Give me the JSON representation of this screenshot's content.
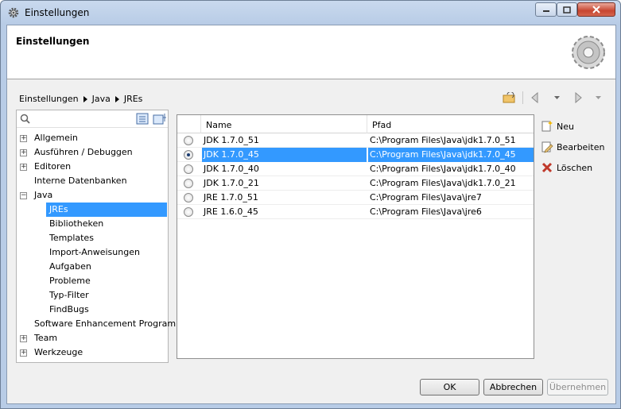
{
  "window": {
    "title": "Einstellungen"
  },
  "banner": {
    "title": "Einstellungen"
  },
  "breadcrumb": [
    "Einstellungen",
    "Java",
    "JREs"
  ],
  "filter": {
    "value": ""
  },
  "tree": [
    {
      "label": "Allgemein",
      "expandable": true
    },
    {
      "label": "Ausführen / Debuggen",
      "expandable": true
    },
    {
      "label": "Editoren",
      "expandable": true
    },
    {
      "label": "Interne Datenbanken",
      "expandable": false
    },
    {
      "label": "Java",
      "expandable": true,
      "expanded": true
    },
    {
      "label": "JREs",
      "child": true,
      "selected": true
    },
    {
      "label": "Bibliotheken",
      "child": true
    },
    {
      "label": "Templates",
      "child": true
    },
    {
      "label": "Import-Anweisungen",
      "child": true
    },
    {
      "label": "Aufgaben",
      "child": true
    },
    {
      "label": "Probleme",
      "child": true
    },
    {
      "label": "Typ-Filter",
      "child": true
    },
    {
      "label": "FindBugs",
      "child": true
    },
    {
      "label": "Software Enhancement Program",
      "expandable": false
    },
    {
      "label": "Team",
      "expandable": true
    },
    {
      "label": "Werkzeuge",
      "expandable": true
    }
  ],
  "table": {
    "columns": [
      "Name",
      "Pfad"
    ],
    "rows": [
      {
        "name": "JDK 1.7.0_51",
        "path": "C:\\Program Files\\Java\\jdk1.7.0_51",
        "checked": false,
        "selected": false
      },
      {
        "name": "JDK 1.7.0_45",
        "path": "C:\\Program Files\\Java\\jdk1.7.0_45",
        "checked": true,
        "selected": true
      },
      {
        "name": "JDK 1.7.0_40",
        "path": "C:\\Program Files\\Java\\jdk1.7.0_40",
        "checked": false,
        "selected": false
      },
      {
        "name": "JDK 1.7.0_21",
        "path": "C:\\Program Files\\Java\\jdk1.7.0_21",
        "checked": false,
        "selected": false
      },
      {
        "name": "JRE 1.7.0_51",
        "path": "C:\\Program Files\\Java\\jre7",
        "checked": false,
        "selected": false
      },
      {
        "name": "JRE 1.6.0_45",
        "path": "C:\\Program Files\\Java\\jre6",
        "checked": false,
        "selected": false
      }
    ]
  },
  "side_buttons": {
    "new": "Neu",
    "edit": "Bearbeiten",
    "delete": "Löschen"
  },
  "footer": {
    "ok": "OK",
    "cancel": "Abbrechen",
    "apply": "Übernehmen"
  }
}
